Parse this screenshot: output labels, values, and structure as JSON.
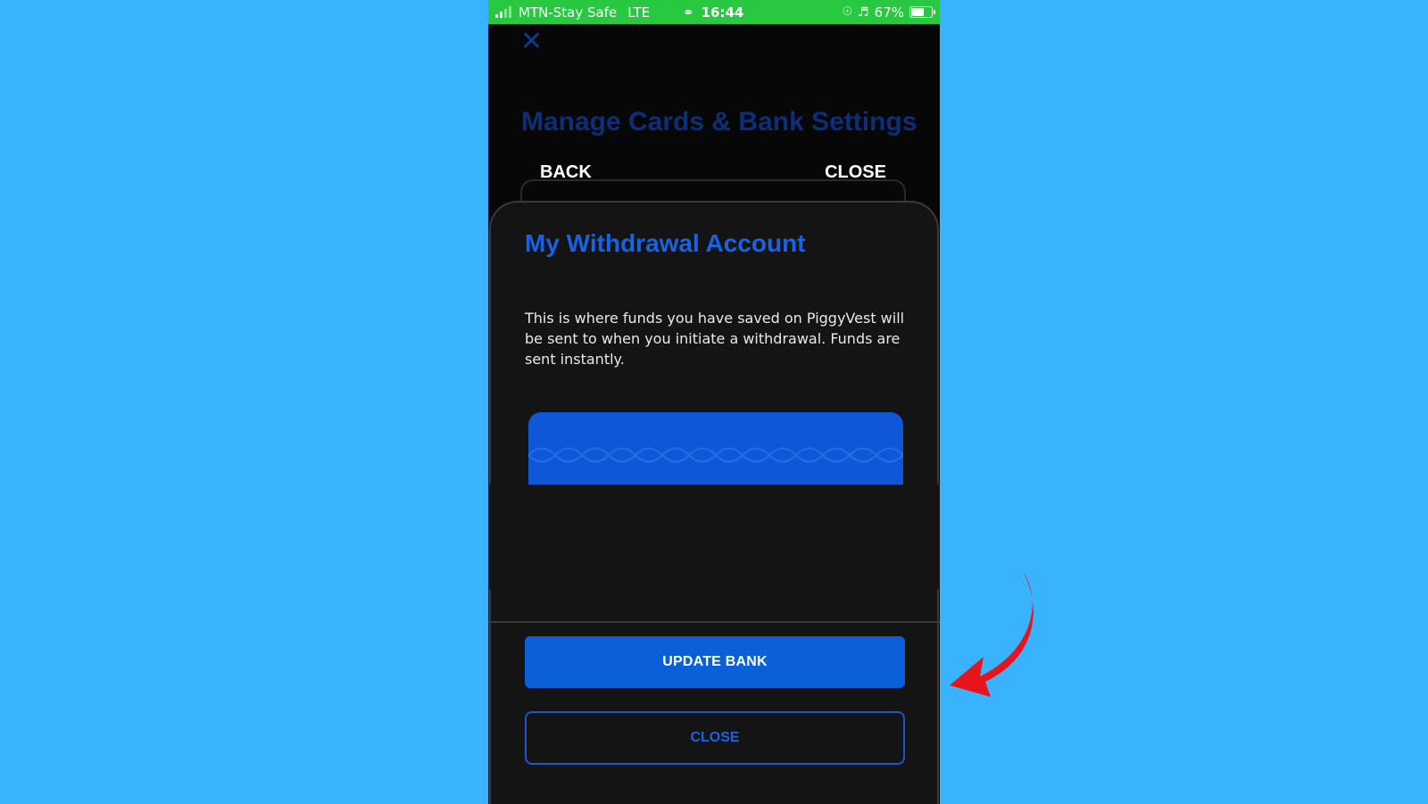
{
  "status_bar": {
    "carrier": "MTN-Stay Safe",
    "network": "LTE",
    "time": "16:44",
    "battery": "67%"
  },
  "background_screen": {
    "title": "Manage Cards & Bank Settings",
    "back_label": "BACK",
    "close_label": "CLOSE",
    "close_icon": "close-x-icon"
  },
  "sheet": {
    "title": "My Withdrawal Account",
    "description": "This is where funds you have saved on PiggyVest will be sent to when you initiate a withdrawal. Funds are sent instantly.",
    "update_button": "UPDATE BANK",
    "close_button": "CLOSE"
  },
  "colors": {
    "page_background": "#39b3fd",
    "accent_blue": "#0b5fd8",
    "status_green": "#28c940",
    "annotation_red": "#e8141b"
  }
}
